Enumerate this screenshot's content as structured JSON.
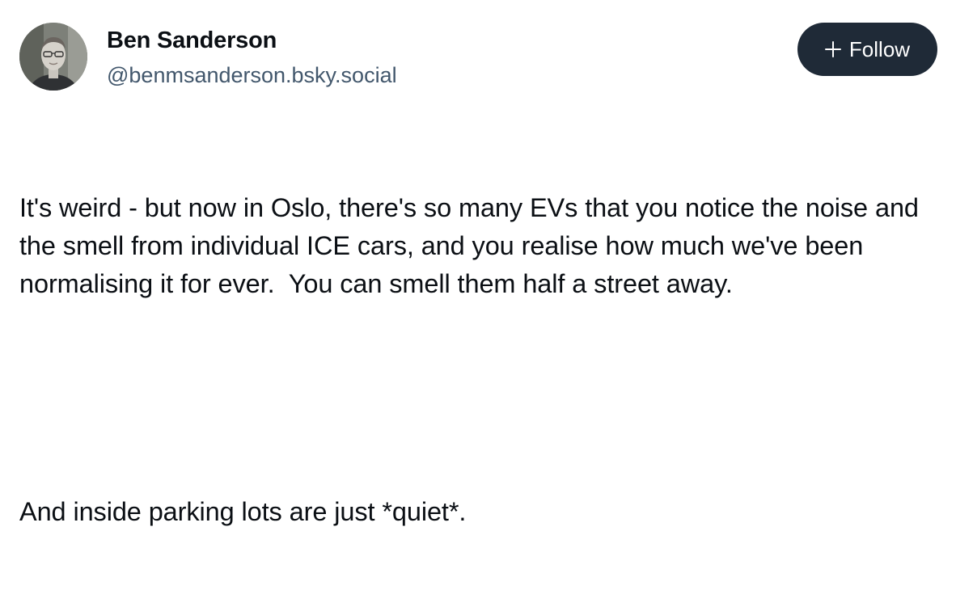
{
  "post": {
    "author": {
      "display_name": "Ben Sanderson",
      "handle": "@benmsanderson.bsky.social",
      "avatar_icon": "user-photo-avatar"
    },
    "follow_button": {
      "label": "Follow",
      "icon": "plus-icon",
      "background": "#1f2a37"
    },
    "text_paragraphs": [
      "It's weird - but now in Oslo, there's so many EVs that you notice the noise and the smell from individual ICE cars, and you realise how much we've been normalising it for ever.  You can smell them half a street away.",
      "And inside parking lots are just *quiet*."
    ]
  }
}
